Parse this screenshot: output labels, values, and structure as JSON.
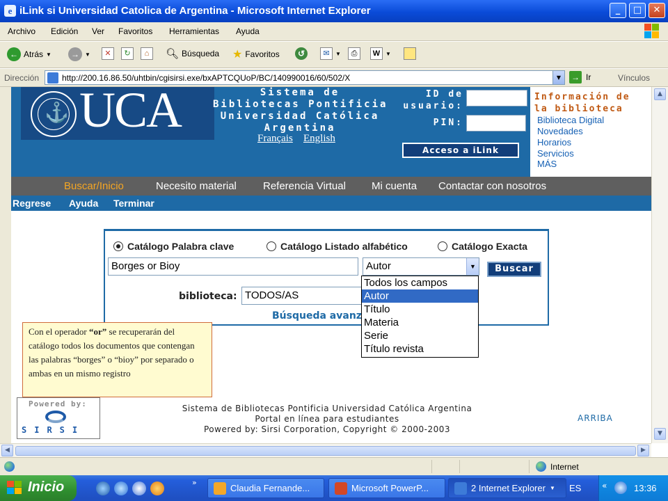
{
  "window": {
    "title": "iLink si Universidad Catolica de Argentina - Microsoft Internet Explorer",
    "app_icon": "e"
  },
  "menu": [
    "Archivo",
    "Edición",
    "Ver",
    "Favoritos",
    "Herramientas",
    "Ayuda"
  ],
  "toolbar": {
    "back_label": "Atrás",
    "search_label": "Búsqueda",
    "favorites_label": "Favoritos"
  },
  "address": {
    "label": "Dirección",
    "url": "http://200.16.86.50/uhtbin/cgisirsi.exe/bxAPTCQUoP/BC/140990016/60/502/X",
    "go_label": "Ir",
    "links_label": "Vínculos"
  },
  "header": {
    "logo_text": "UCA",
    "system_lines": [
      "Sistema de",
      "Bibliotecas Pontificia",
      "Universidad Católica",
      "Argentina"
    ],
    "lang_fr": "Français",
    "lang_en": "English",
    "id_label": "ID de\nusuario:",
    "pin_label": "PIN:",
    "login_button": "Acceso a iLink",
    "info_heading": "Información de\nla biblioteca",
    "info_links": [
      "Biblioteca Digital",
      "Novedades",
      "Horarios",
      "Servicios",
      "MÁS"
    ]
  },
  "nav_main": [
    "Buscar/Inicio",
    "Necesito material",
    "Referencia Virtual",
    "Mi cuenta",
    "Contactar con nosotros"
  ],
  "nav_sub": [
    "Regrese",
    "Ayuda",
    "Terminar"
  ],
  "search": {
    "radios": [
      "Catálogo Palabra clave",
      "Catálogo Listado alfabético",
      "Catálogo Exacta"
    ],
    "selected_radio": 0,
    "query": "Borges or Bioy",
    "field_selected": "Autor",
    "button": "Buscar",
    "library_label": "biblioteca:",
    "library_value": "TODOS/AS",
    "advanced_label": "Búsqueda avanz",
    "dropdown_options": [
      "Todos los campos",
      "Autor",
      "Título",
      "Materia",
      "Serie",
      "Título revista"
    ],
    "dropdown_selected_index": 1
  },
  "note": {
    "part1": "Con el operador ",
    "bold": "“or”",
    "part2": " se recuperarán del catálogo todos los documentos que contengan las palabras  “borges” o “bioy” por separado o ambas en un mismo registro"
  },
  "footer": {
    "powered_by": "Powered by:",
    "sirsi": "SIRSI",
    "line1": "Sistema de Bibliotecas Pontificia Universidad Católica Argentina",
    "line2": "Portal en línea para estudiantes",
    "line3": "Powered by: Sirsi Corporation, Copyright © 2000-2003",
    "top_link": "ARRIBA"
  },
  "status": {
    "zone": "Internet"
  },
  "taskbar": {
    "start": "Inicio",
    "tasks": [
      "Claudia Fernande...",
      "Microsoft PowerP...",
      "2 Internet Explorer"
    ],
    "language": "ES",
    "clock": "13:36"
  },
  "colors": {
    "brand_blue": "#1e6aa6",
    "dark_navy": "#123e7a",
    "nav_gray": "#5f5f5f",
    "info_orange": "#c05a14",
    "link_blue": "#1560b4",
    "note_bg": "#fffbd0",
    "selection_blue": "#316ac5"
  }
}
